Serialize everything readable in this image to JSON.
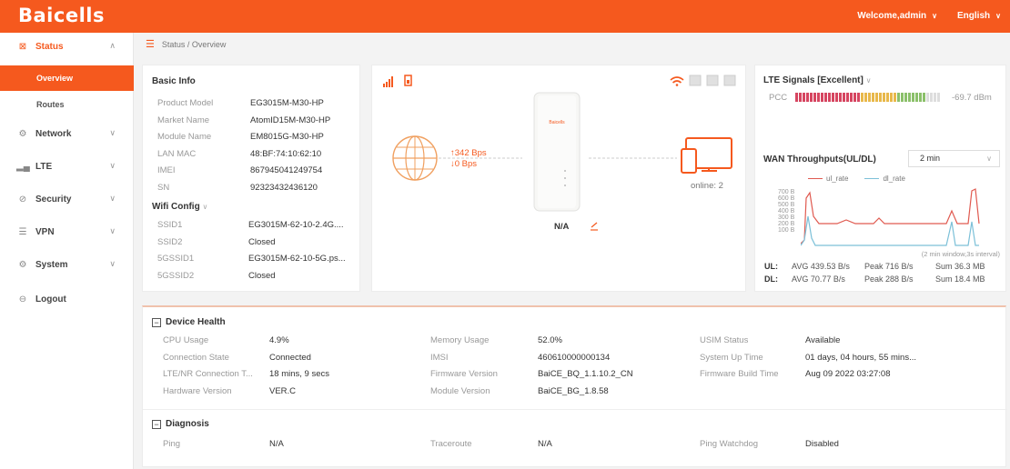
{
  "header": {
    "logo": "Baicells",
    "welcome": "Welcome,admin",
    "language": "English"
  },
  "sidebar": {
    "status": "Status",
    "overview": "Overview",
    "routes": "Routes",
    "network": "Network",
    "lte": "LTE",
    "security": "Security",
    "vpn": "VPN",
    "system": "System",
    "logout": "Logout"
  },
  "breadcrumb": "Status / Overview",
  "basic_info": {
    "title": "Basic Info",
    "rows": [
      {
        "k": "Product Model",
        "v": "EG3015M-M30-HP"
      },
      {
        "k": "Market Name",
        "v": "AtomID15M-M30-HP"
      },
      {
        "k": "Module Name",
        "v": "EM8015G-M30-HP"
      },
      {
        "k": "LAN MAC",
        "v": "48:BF:74:10:62:10"
      },
      {
        "k": "IMEI",
        "v": "867945041249754"
      },
      {
        "k": "SN",
        "v": "92323432436120"
      }
    ],
    "wifi_title": "Wifi Config",
    "wifi_rows": [
      {
        "k": "SSID1",
        "v": "EG3015M-62-10-2.4G...."
      },
      {
        "k": "SSID2",
        "v": "Closed"
      },
      {
        "k": "5GSSID1",
        "v": "EG3015M-62-10-5G.ps..."
      },
      {
        "k": "5GSSID2",
        "v": "Closed"
      }
    ]
  },
  "topology": {
    "upload": "↑342 Bps",
    "download": "↓0 Bps",
    "device_status": "N/A",
    "online": "online: 2",
    "router_brand": "Baicells"
  },
  "lte_signals": {
    "title": "LTE Signals [Excellent]",
    "pcc_label": "PCC",
    "pcc_value": "-69.7 dBm",
    "level": 0.9
  },
  "wan": {
    "title": "WAN Throughputs(UL/DL)",
    "period": "2 min",
    "legend_ul": "ul_rate",
    "legend_dl": "dl_rate",
    "y_ticks": [
      "700 B",
      "600 B",
      "500 B",
      "400 B",
      "300 B",
      "200 B",
      "100 B"
    ],
    "interval_note": "(2 min window,3s interval)",
    "ul_label": "UL:",
    "ul_avg": "AVG  439.53 B/s",
    "ul_peak": "Peak  716 B/s",
    "ul_sum": "Sum  36.3 MB",
    "dl_label": "DL:",
    "dl_avg": "AVG  70.77 B/s",
    "dl_peak": "Peak  288 B/s",
    "dl_sum": "Sum  18.4 MB"
  },
  "device_health": {
    "title": "Device Health",
    "rows": [
      [
        {
          "k": "CPU Usage",
          "v": "4.9%"
        },
        {
          "k": "Memory Usage",
          "v": "52.0%"
        },
        {
          "k": "USIM Status",
          "v": "Available"
        }
      ],
      [
        {
          "k": "Connection State",
          "v": "Connected"
        },
        {
          "k": "IMSI",
          "v": "460610000000134"
        },
        {
          "k": "System Up Time",
          "v": "01 days, 04 hours, 55 mins..."
        }
      ],
      [
        {
          "k": "LTE/NR Connection T...",
          "v": "18 mins, 9 secs"
        },
        {
          "k": "Firmware Version",
          "v": "BaiCE_BQ_1.1.10.2_CN"
        },
        {
          "k": "Firmware Build Time",
          "v": "Aug 09 2022 03:27:08"
        }
      ],
      [
        {
          "k": "Hardware Version",
          "v": "VER.C"
        },
        {
          "k": "Module Version",
          "v": "BaiCE_BG_1.8.58"
        },
        {
          "k": "",
          "v": ""
        }
      ]
    ]
  },
  "diagnosis": {
    "title": "Diagnosis",
    "row": [
      {
        "k": "Ping",
        "v": "N/A"
      },
      {
        "k": "Traceroute",
        "v": "N/A"
      },
      {
        "k": "Ping Watchdog",
        "v": "Disabled"
      }
    ]
  }
}
